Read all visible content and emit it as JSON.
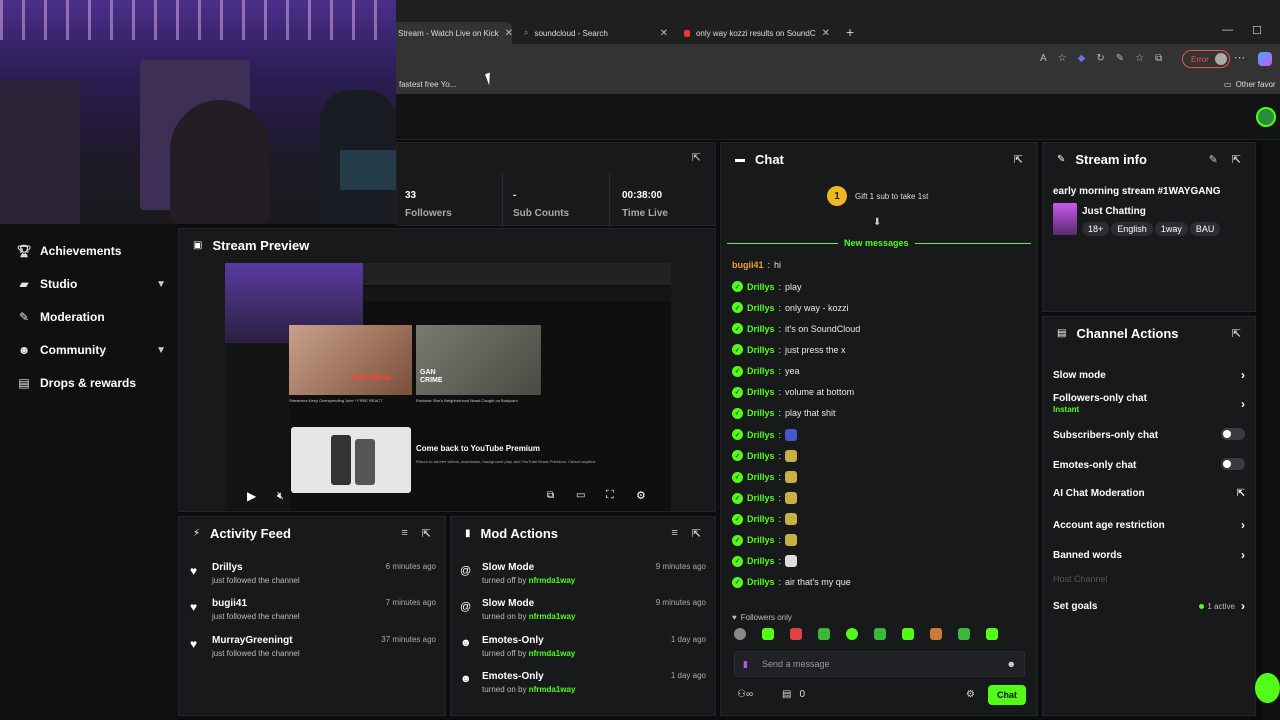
{
  "browser": {
    "tabs": [
      {
        "label": "Stream - Watch Live on Kick"
      },
      {
        "label": "soundcloud - Search"
      },
      {
        "label": "only way kozzi results on SoundC"
      }
    ],
    "error_label": "Error",
    "bookmarks": {
      "first": "fastest free Yo...",
      "other": "Other favor"
    }
  },
  "sidebar": {
    "items": [
      {
        "label": "Achievements",
        "icon": "trophy-icon",
        "chevron": false
      },
      {
        "label": "Studio",
        "icon": "studio-icon",
        "chevron": true
      },
      {
        "label": "Moderation",
        "icon": "wrench-icon",
        "chevron": false
      },
      {
        "label": "Community",
        "icon": "community-icon",
        "chevron": true
      },
      {
        "label": "Drops & rewards",
        "icon": "gift-icon",
        "chevron": false
      }
    ]
  },
  "stats": {
    "followers_value": "33",
    "followers_label": "Followers",
    "subs_value": "-",
    "subs_label": "Sub Counts",
    "time_value": "00:38:00",
    "time_label": "Time Live"
  },
  "preview": {
    "title": "Stream Preview",
    "yt_premium_title": "Come back to YouTube Premium",
    "yt_premium_sub": "Return to ad-free videos, downloads, background play, and YouTube Music Premium. Cancel anytime",
    "thumb1_caption": "Streamers Keep Overspending Joint * FREE REACT",
    "thumb1_overlay": "GAN CRIME",
    "thumb2_caption": "Rockstar Star's Neighborhood Brawl Caught on Bodycam"
  },
  "activity": {
    "title": "Activity Feed",
    "rows": [
      {
        "name": "Drillys",
        "sub": "just followed the channel",
        "time": "6 minutes ago"
      },
      {
        "name": "bugii41",
        "sub": "just followed the channel",
        "time": "7 minutes ago"
      },
      {
        "name": "MurrayGreeningt",
        "sub": "just followed the channel",
        "time": "37 minutes ago"
      }
    ]
  },
  "mod_actions": {
    "title": "Mod Actions",
    "rows": [
      {
        "name": "Slow Mode",
        "pre": "turned off by",
        "by": "nfrmda1way",
        "time": "9 minutes ago",
        "icon": "snail-icon"
      },
      {
        "name": "Slow Mode",
        "pre": "turned on by",
        "by": "nfrmda1way",
        "time": "9 minutes ago",
        "icon": "snail-icon"
      },
      {
        "name": "Emotes-Only",
        "pre": "turned off by",
        "by": "nfrmda1way",
        "time": "1 day ago",
        "icon": "smiley-icon"
      },
      {
        "name": "Emotes-Only",
        "pre": "turned on by",
        "by": "nfrmda1way",
        "time": "1 day ago",
        "icon": "smiley-icon"
      }
    ]
  },
  "chat": {
    "title": "Chat",
    "gift_count": "1",
    "gift_text": "Gift 1 sub to take 1st",
    "new_messages": "New messages",
    "messages": [
      {
        "user": "bugii41",
        "text": "hi",
        "badge": false,
        "color": "#f0a030",
        "emote": null
      },
      {
        "user": "Drillys",
        "text": "play",
        "badge": true,
        "color": "#53fc18",
        "emote": null
      },
      {
        "user": "Drillys",
        "text": "only way - kozzi",
        "badge": true,
        "color": "#53fc18",
        "emote": null
      },
      {
        "user": "Drillys",
        "text": "it's on SoundCloud",
        "badge": true,
        "color": "#53fc18",
        "emote": null
      },
      {
        "user": "Drillys",
        "text": "just press the x",
        "badge": true,
        "color": "#53fc18",
        "emote": null
      },
      {
        "user": "Drillys",
        "text": "yea",
        "badge": true,
        "color": "#53fc18",
        "emote": null
      },
      {
        "user": "Drillys",
        "text": "volume at bottom",
        "badge": true,
        "color": "#53fc18",
        "emote": null
      },
      {
        "user": "Drillys",
        "text": "play that shit",
        "badge": true,
        "color": "#53fc18",
        "emote": null
      },
      {
        "user": "Drillys",
        "text": "",
        "badge": true,
        "color": "#53fc18",
        "emote": "#4a55c9"
      },
      {
        "user": "Drillys",
        "text": "",
        "badge": true,
        "color": "#53fc18",
        "emote": "#c8b046"
      },
      {
        "user": "Drillys",
        "text": "",
        "badge": true,
        "color": "#53fc18",
        "emote": "#c8b046"
      },
      {
        "user": "Drillys",
        "text": "",
        "badge": true,
        "color": "#53fc18",
        "emote": "#c8b046"
      },
      {
        "user": "Drillys",
        "text": "",
        "badge": true,
        "color": "#53fc18",
        "emote": "#c8b046"
      },
      {
        "user": "Drillys",
        "text": "",
        "badge": true,
        "color": "#53fc18",
        "emote": "#c8b046"
      },
      {
        "user": "Drillys",
        "text": "",
        "badge": true,
        "color": "#53fc18",
        "emote": "#dddddd"
      },
      {
        "user": "Drillys",
        "text": "air that's my que",
        "badge": true,
        "color": "#53fc18",
        "emote": null
      }
    ],
    "followers_only": "Followers only",
    "input_placeholder": "Send a message",
    "gift_balance": "0",
    "send_label": "Chat"
  },
  "stream_info": {
    "title": "Stream info",
    "stream_title": "early morning stream #1WAYGANG",
    "category": "Just Chatting",
    "tags": [
      "18+",
      "English",
      "1way",
      "BAU"
    ]
  },
  "channel_actions": {
    "title": "Channel Actions",
    "slow_mode": "Slow mode",
    "followers_only": "Followers-only chat",
    "followers_only_sub": "Instant",
    "subs_only": "Subscribers-only chat",
    "emotes_only": "Emotes-only chat",
    "ai_moderation": "AI Chat Moderation",
    "account_age": "Account age restriction",
    "banned_words": "Banned words",
    "host_channel": "Host Channel",
    "set_goals": "Set goals",
    "goals_active": "1 active"
  },
  "colors": {
    "accent": "#53fc18",
    "panel": "#18191b",
    "bg": "#0b0c0d"
  }
}
